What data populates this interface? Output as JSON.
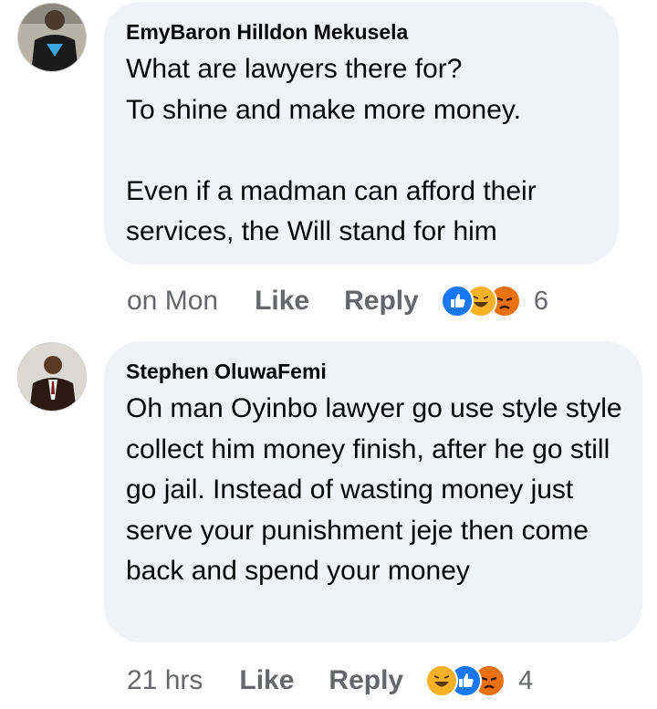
{
  "comments": [
    {
      "author": "EmyBaron Hilldon Mekusela",
      "text": "What are lawyers there for?\nTo shine and make more money.\n\nEven if a madman can afford their services, the Will stand for him",
      "time": "on Mon",
      "like_label": "Like",
      "reply_label": "Reply",
      "reaction_count": "6",
      "reactions": [
        "like",
        "haha",
        "angry"
      ]
    },
    {
      "author": "Stephen OluwaFemi",
      "text": "Oh man Oyinbo lawyer go use style style collect him money finish, after he go still go jail. Instead of wasting money just serve your punishment jeje then come back and spend your money",
      "time": "21 hrs",
      "like_label": "Like",
      "reply_label": "Reply",
      "reaction_count": "4",
      "reactions": [
        "haha",
        "like",
        "angry"
      ]
    }
  ],
  "colors": {
    "bubble": "#f0f2f5",
    "meta_text": "#65676b",
    "like_blue": "#1877f2",
    "haha_yellow": "#f7b125",
    "angry_red": "#e9710f"
  }
}
